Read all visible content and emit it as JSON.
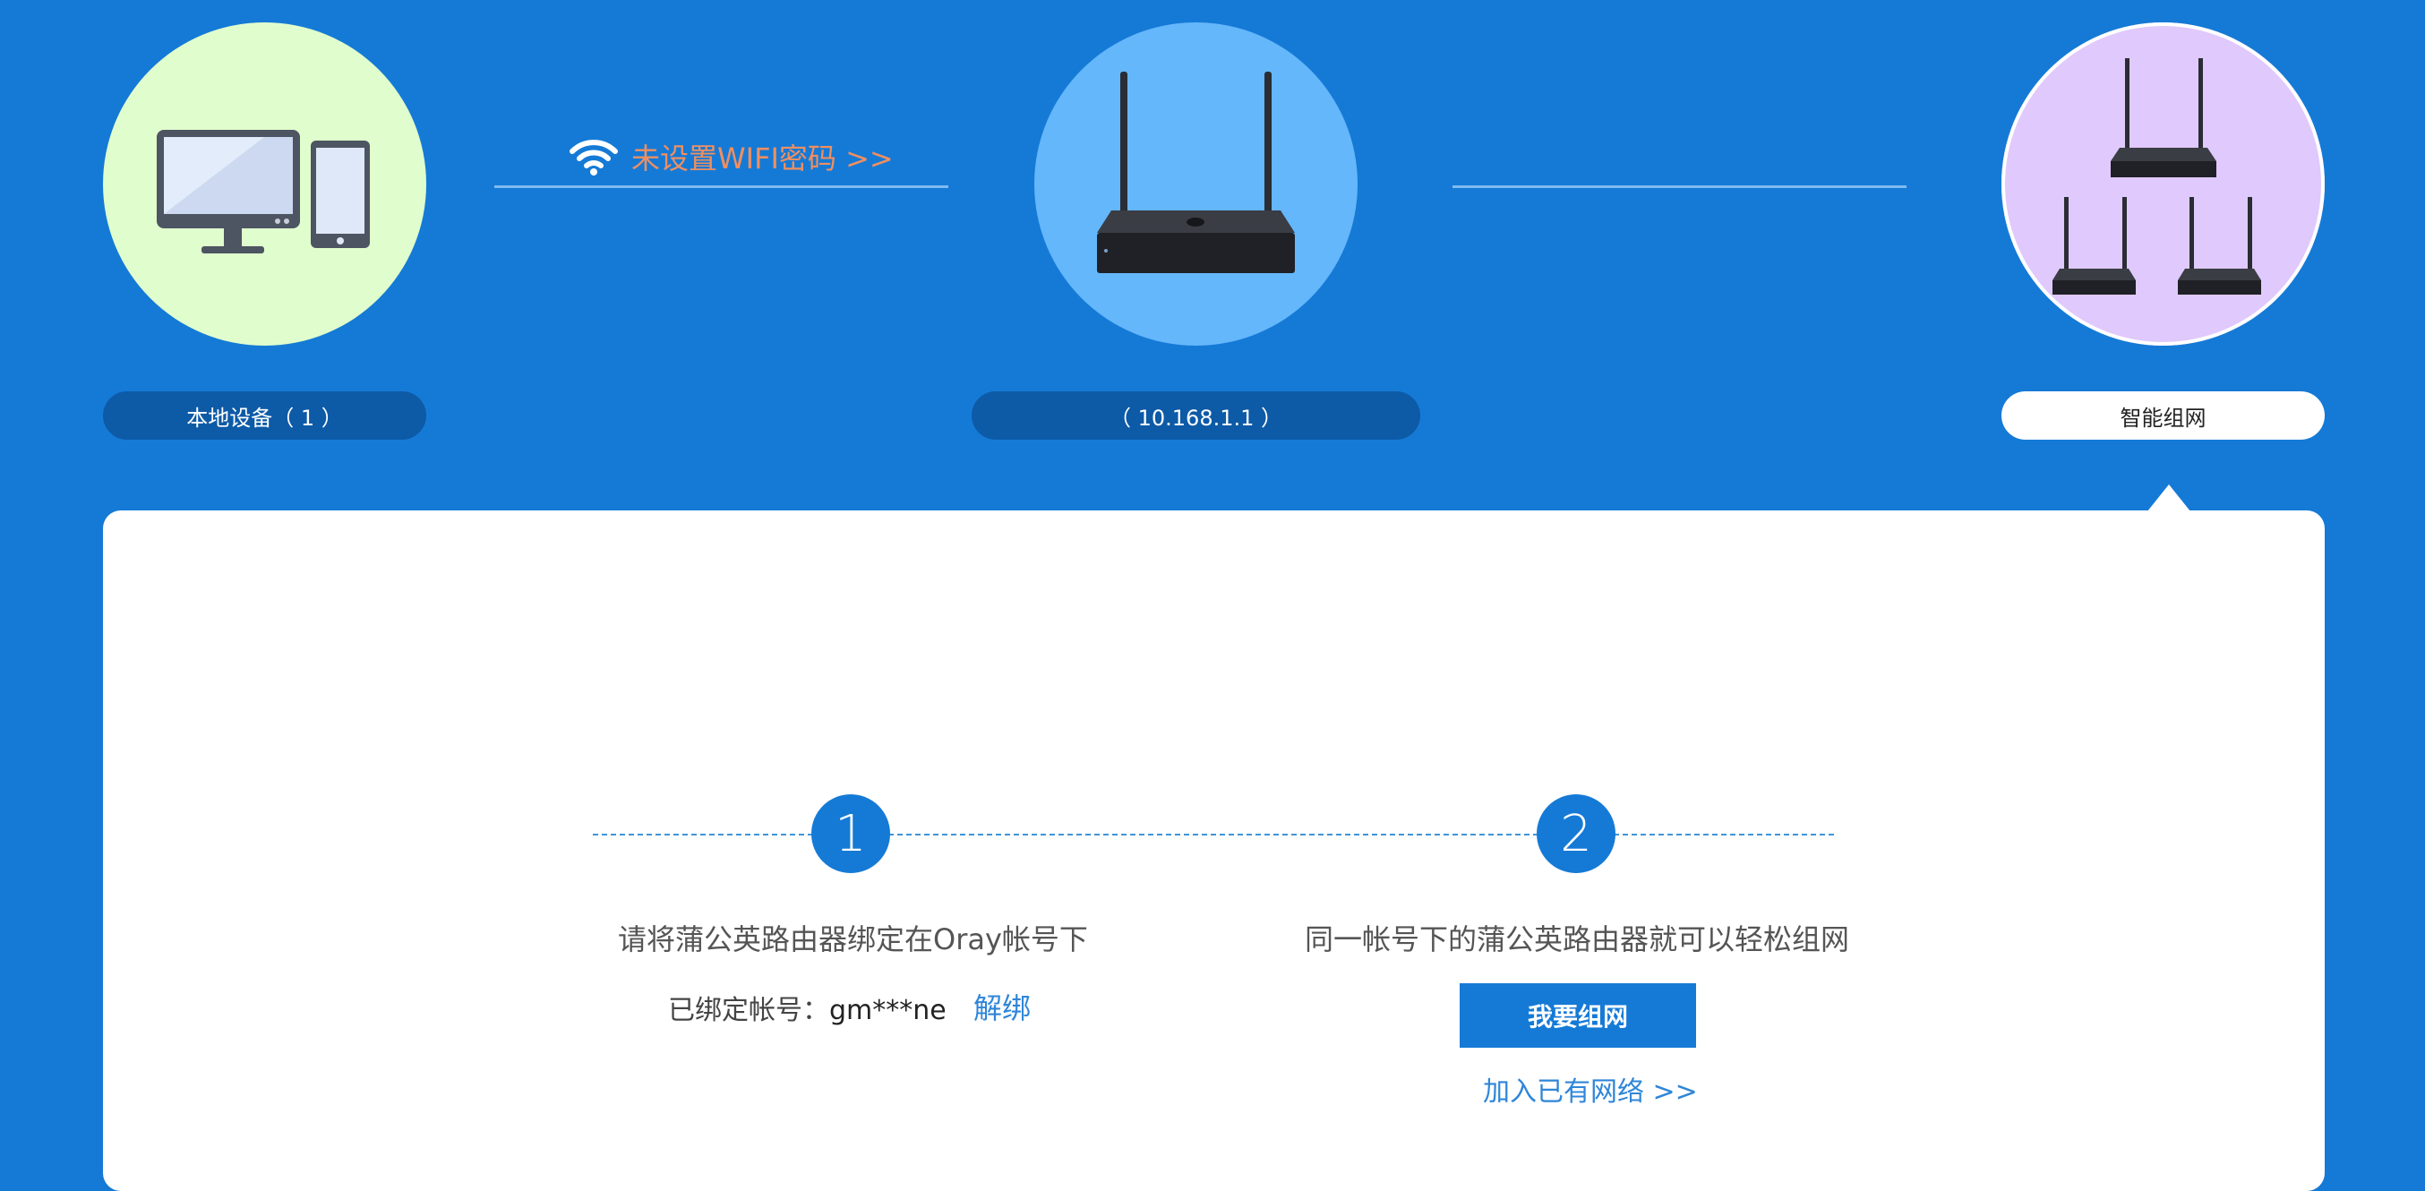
{
  "topology": {
    "wifi_warning": "未设置WIFI密码 >>",
    "local_devices_label": "本地设备（ 1 ）",
    "router_ip_label": "（ 10.168.1.1 ）",
    "smart_network_label": "智能组网"
  },
  "icons": {
    "devices": "desktop-and-tablet-icon",
    "wifi": "wifi-icon",
    "router": "router-icon",
    "network": "multi-router-network-icon"
  },
  "colors": {
    "background": "#157ad6",
    "local_devices_circle": "#e0fdcd",
    "router_circle": "#64b7fb",
    "network_circle": "#e0c9fc",
    "warning_text": "#ef8f61",
    "link": "#2f86d8"
  },
  "steps": [
    {
      "number": "1",
      "description": "请将蒲公英路由器绑定在Oray帐号下",
      "bound_label": "已绑定帐号：",
      "bound_account": "gm***ne",
      "unbind_link": "解绑"
    },
    {
      "number": "2",
      "description": "同一帐号下的蒲公英路由器就可以轻松组网",
      "create_button": "我要组网",
      "join_link": "加入已有网络 >>"
    }
  ]
}
